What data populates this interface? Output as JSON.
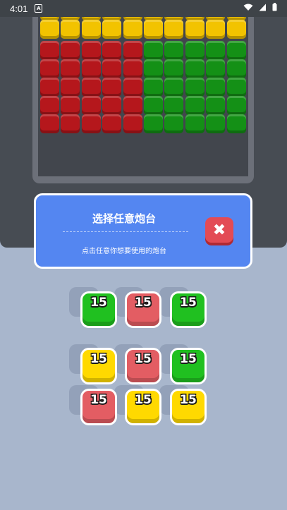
{
  "status_bar": {
    "time": "4:01",
    "notif_glyph": "A"
  },
  "board": {
    "rows": [
      [
        "yellow",
        "yellow",
        "yellow",
        "yellow",
        "yellow",
        "yellow",
        "yellow",
        "yellow",
        "yellow",
        "yellow"
      ],
      [
        "yellow",
        "yellow",
        "yellow",
        "yellow",
        "yellow",
        "yellow",
        "yellow",
        "yellow",
        "yellow",
        "yellow"
      ],
      [
        "red",
        "red",
        "red",
        "red",
        "red",
        "green",
        "green",
        "green",
        "green",
        "green"
      ],
      [
        "red",
        "red",
        "red",
        "red",
        "red",
        "green",
        "green",
        "green",
        "green",
        "green"
      ],
      [
        "red",
        "red",
        "red",
        "red",
        "red",
        "green",
        "green",
        "green",
        "green",
        "green"
      ],
      [
        "red",
        "red",
        "red",
        "red",
        "red",
        "green",
        "green",
        "green",
        "green",
        "green"
      ],
      [
        "red",
        "red",
        "red",
        "red",
        "red",
        "green",
        "green",
        "green",
        "green",
        "green"
      ]
    ]
  },
  "dialog": {
    "title": "选择任意炮台",
    "subtitle": "点击任意你想要使用的炮台",
    "close_glyph": "✖"
  },
  "turrets": {
    "top": [
      {
        "color": "green",
        "count": "15"
      },
      {
        "color": "red",
        "count": "15"
      },
      {
        "color": "green",
        "count": "15"
      }
    ],
    "bottom": [
      [
        {
          "color": "yellow",
          "count": "15"
        },
        {
          "color": "red",
          "count": "15"
        },
        {
          "color": "green",
          "count": "15"
        }
      ],
      [
        {
          "color": "red",
          "count": "15"
        },
        {
          "color": "yellow",
          "count": "15"
        },
        {
          "color": "yellow",
          "count": "15"
        }
      ]
    ]
  }
}
